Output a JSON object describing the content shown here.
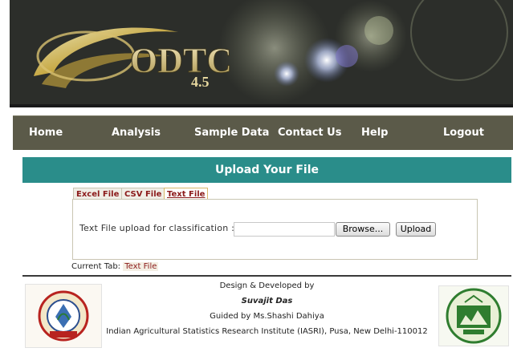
{
  "header": {
    "logo_text": "ODTC",
    "version": "4.5"
  },
  "nav": {
    "items": [
      {
        "label": "Home"
      },
      {
        "label": "Analysis"
      },
      {
        "label": "Sample Data"
      },
      {
        "label": "Contact Us"
      },
      {
        "label": "Help"
      },
      {
        "label": "Logout"
      }
    ]
  },
  "banner": {
    "title": "Upload Your File"
  },
  "tabs": [
    {
      "label": "Excel File"
    },
    {
      "label": "CSV File"
    },
    {
      "label": "Text File",
      "active": true
    }
  ],
  "upload": {
    "label": "Text File upload for classification :",
    "file_value": "",
    "browse_label": "Browse...",
    "upload_label": "Upload"
  },
  "current_tab": {
    "prefix": "Current Tab:",
    "value": "Text File"
  },
  "footer": {
    "line1": "Design & Developed by",
    "author": "Suvajit Das",
    "guide": "Guided by Ms.Shashi Dahiya",
    "institute": "Indian Agricultural Statistics Research Institute (IASRI), Pusa, New Delhi-110012"
  },
  "colors": {
    "nav_bg": "#5b5a49",
    "banner_bg": "#2a8d8a",
    "tab_text": "#8b1a1a"
  }
}
